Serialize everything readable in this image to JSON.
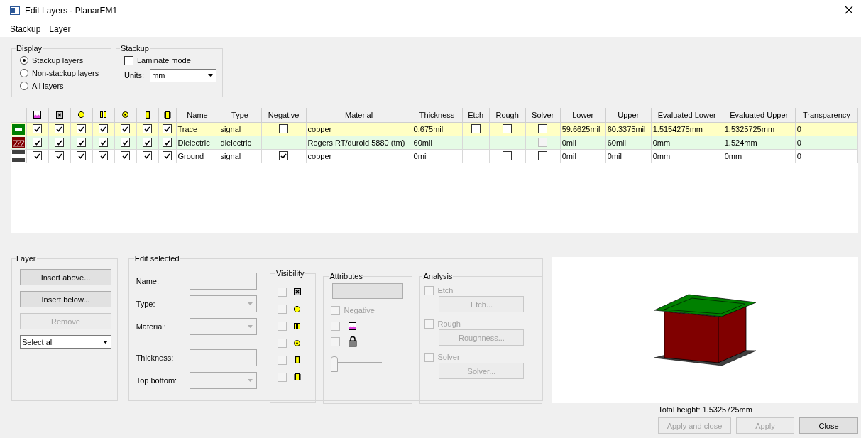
{
  "window": {
    "title": "Edit Layers - PlanarEM1"
  },
  "menu": [
    {
      "label": "Stackup"
    },
    {
      "label": "Layer"
    }
  ],
  "display": {
    "title": "Display",
    "options": [
      {
        "label": "Stackup layers",
        "selected": true
      },
      {
        "label": "Non-stackup layers",
        "selected": false
      },
      {
        "label": "All layers",
        "selected": false
      }
    ]
  },
  "stackup": {
    "title": "Stackup",
    "laminate": {
      "label": "Laminate mode",
      "checked": false
    },
    "units": {
      "label": "Units:",
      "value": "mm"
    }
  },
  "table": {
    "columns": [
      "Name",
      "Type",
      "Negative",
      "Material",
      "Thickness",
      "Etch",
      "Rough",
      "Solver",
      "Lower",
      "Upper",
      "Evaluated Lower",
      "Evaluated Upper",
      "Transparency"
    ],
    "rows": [
      {
        "kind": "trace",
        "color": "#008000",
        "selected": true,
        "visibility": [
          {
            "checked": true
          },
          {
            "checked": true
          },
          {
            "checked": true
          },
          {
            "checked": true
          },
          {
            "checked": true
          },
          {
            "checked": true
          },
          {
            "checked": true
          }
        ],
        "name": "Trace",
        "type": "signal",
        "negative": {
          "checked": false
        },
        "material": "copper",
        "thickness": "0.675mil",
        "etch": {
          "checked": false
        },
        "rough": {
          "checked": false
        },
        "solver": {
          "checked": false,
          "disabled": false
        },
        "lower": "59.6625mil",
        "upper": "60.3375mil",
        "evaluated_lower": "1.5154275mm",
        "evaluated_upper": "1.5325725mm",
        "transparency": "0"
      },
      {
        "kind": "dielectric",
        "color": "#800000",
        "selected": false,
        "visibility": [
          {
            "checked": true
          },
          {
            "checked": true
          },
          {
            "checked": true
          },
          {
            "checked": true
          },
          {
            "checked": true
          },
          {
            "checked": true
          },
          {
            "checked": true
          }
        ],
        "name": "Dielectric",
        "type": "dielectric",
        "material": "Rogers RT/duroid 5880 (tm)",
        "thickness": "60mil",
        "solver": {
          "checked": false,
          "disabled": true
        },
        "lower": "0mil",
        "upper": "60mil",
        "evaluated_lower": "0mm",
        "evaluated_upper": "1.524mm",
        "transparency": "0"
      },
      {
        "kind": "plane",
        "color": "#404040",
        "selected": false,
        "visibility": [
          {
            "checked": true
          },
          {
            "checked": true
          },
          {
            "checked": true
          },
          {
            "checked": true
          },
          {
            "checked": true
          },
          {
            "checked": true
          },
          {
            "checked": true
          }
        ],
        "name": "Ground",
        "type": "signal",
        "negative": {
          "checked": true
        },
        "material": "copper",
        "thickness": "0mil",
        "rough": {
          "checked": false
        },
        "solver": {
          "checked": false,
          "disabled": false
        },
        "lower": "0mil",
        "upper": "0mil",
        "evaluated_lower": "0mm",
        "evaluated_upper": "0mm",
        "transparency": "0"
      }
    ]
  },
  "layer_group": {
    "title": "Layer",
    "buttons": [
      {
        "label": "Insert above...",
        "disabled": false
      },
      {
        "label": "Insert below...",
        "disabled": false
      },
      {
        "label": "Remove",
        "disabled": true
      }
    ],
    "select": {
      "value": "Select all"
    }
  },
  "edit_selected": {
    "title": "Edit selected",
    "fields": [
      {
        "label": "Name:",
        "kind": "text",
        "disabled": true
      },
      {
        "label": "Type:",
        "kind": "dropdown",
        "disabled": true
      },
      {
        "label": "Material:",
        "kind": "dropdown",
        "disabled": true
      },
      {
        "label": "Thickness:",
        "kind": "text",
        "disabled": true
      },
      {
        "label": "Top bottom:",
        "kind": "dropdown",
        "disabled": true
      }
    ],
    "visibility": {
      "title": "Visibility",
      "items": [
        {
          "checked": false
        },
        {
          "checked": false
        },
        {
          "checked": false
        },
        {
          "checked": false
        },
        {
          "checked": false
        },
        {
          "checked": false
        }
      ]
    },
    "attributes": {
      "title": "Attributes",
      "negative": {
        "label": "Negative",
        "checked": false,
        "disabled": true
      },
      "items": [
        {
          "checked": false
        },
        {
          "checked": false
        }
      ],
      "transparency": {
        "level": 0
      }
    },
    "analysis": {
      "title": "Analysis",
      "items": [
        {
          "label": "Etch",
          "checked": false,
          "disabled": true,
          "button": "Etch..."
        },
        {
          "label": "Rough",
          "checked": false,
          "disabled": true,
          "button": "Roughness..."
        },
        {
          "label": "Solver",
          "checked": false,
          "disabled": true,
          "button": "Solver..."
        }
      ]
    }
  },
  "preview": {
    "total_height": "Total height: 1.5325725mm"
  },
  "footer": {
    "buttons": [
      {
        "label": "Apply and close",
        "disabled": true
      },
      {
        "label": "Apply",
        "disabled": true
      },
      {
        "label": "Close",
        "disabled": false
      }
    ]
  }
}
